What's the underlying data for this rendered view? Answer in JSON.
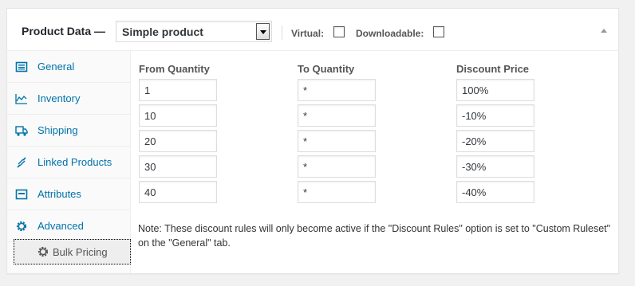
{
  "header": {
    "title": "Product Data —",
    "product_type": "Simple product",
    "virtual_label": "Virtual:",
    "virtual_checked": false,
    "downloadable_label": "Downloadable:",
    "downloadable_checked": false
  },
  "tabs": [
    {
      "label": "General",
      "icon": "general-icon"
    },
    {
      "label": "Inventory",
      "icon": "inventory-icon"
    },
    {
      "label": "Shipping",
      "icon": "shipping-icon"
    },
    {
      "label": "Linked Products",
      "icon": "link-icon"
    },
    {
      "label": "Attributes",
      "icon": "attributes-icon"
    },
    {
      "label": "Advanced",
      "icon": "gear-icon"
    },
    {
      "label": "Bulk Pricing",
      "icon": "gear-icon",
      "active": true
    }
  ],
  "columns": {
    "from": "From Quantity",
    "to": "To Quantity",
    "discount": "Discount Price"
  },
  "rules": [
    {
      "from": "1",
      "to": "*",
      "discount": "100%"
    },
    {
      "from": "10",
      "to": "*",
      "discount": "-10%"
    },
    {
      "from": "20",
      "to": "*",
      "discount": "-20%"
    },
    {
      "from": "30",
      "to": "*",
      "discount": "-30%"
    },
    {
      "from": "40",
      "to": "*",
      "discount": "-40%"
    }
  ],
  "note": "Note: These discount rules will only become active if the \"Discount Rules\" option is set to \"Custom Ruleset\" on the \"General\" tab.",
  "colors": {
    "link": "#0073aa",
    "text": "#333333",
    "border": "#dddddd"
  }
}
